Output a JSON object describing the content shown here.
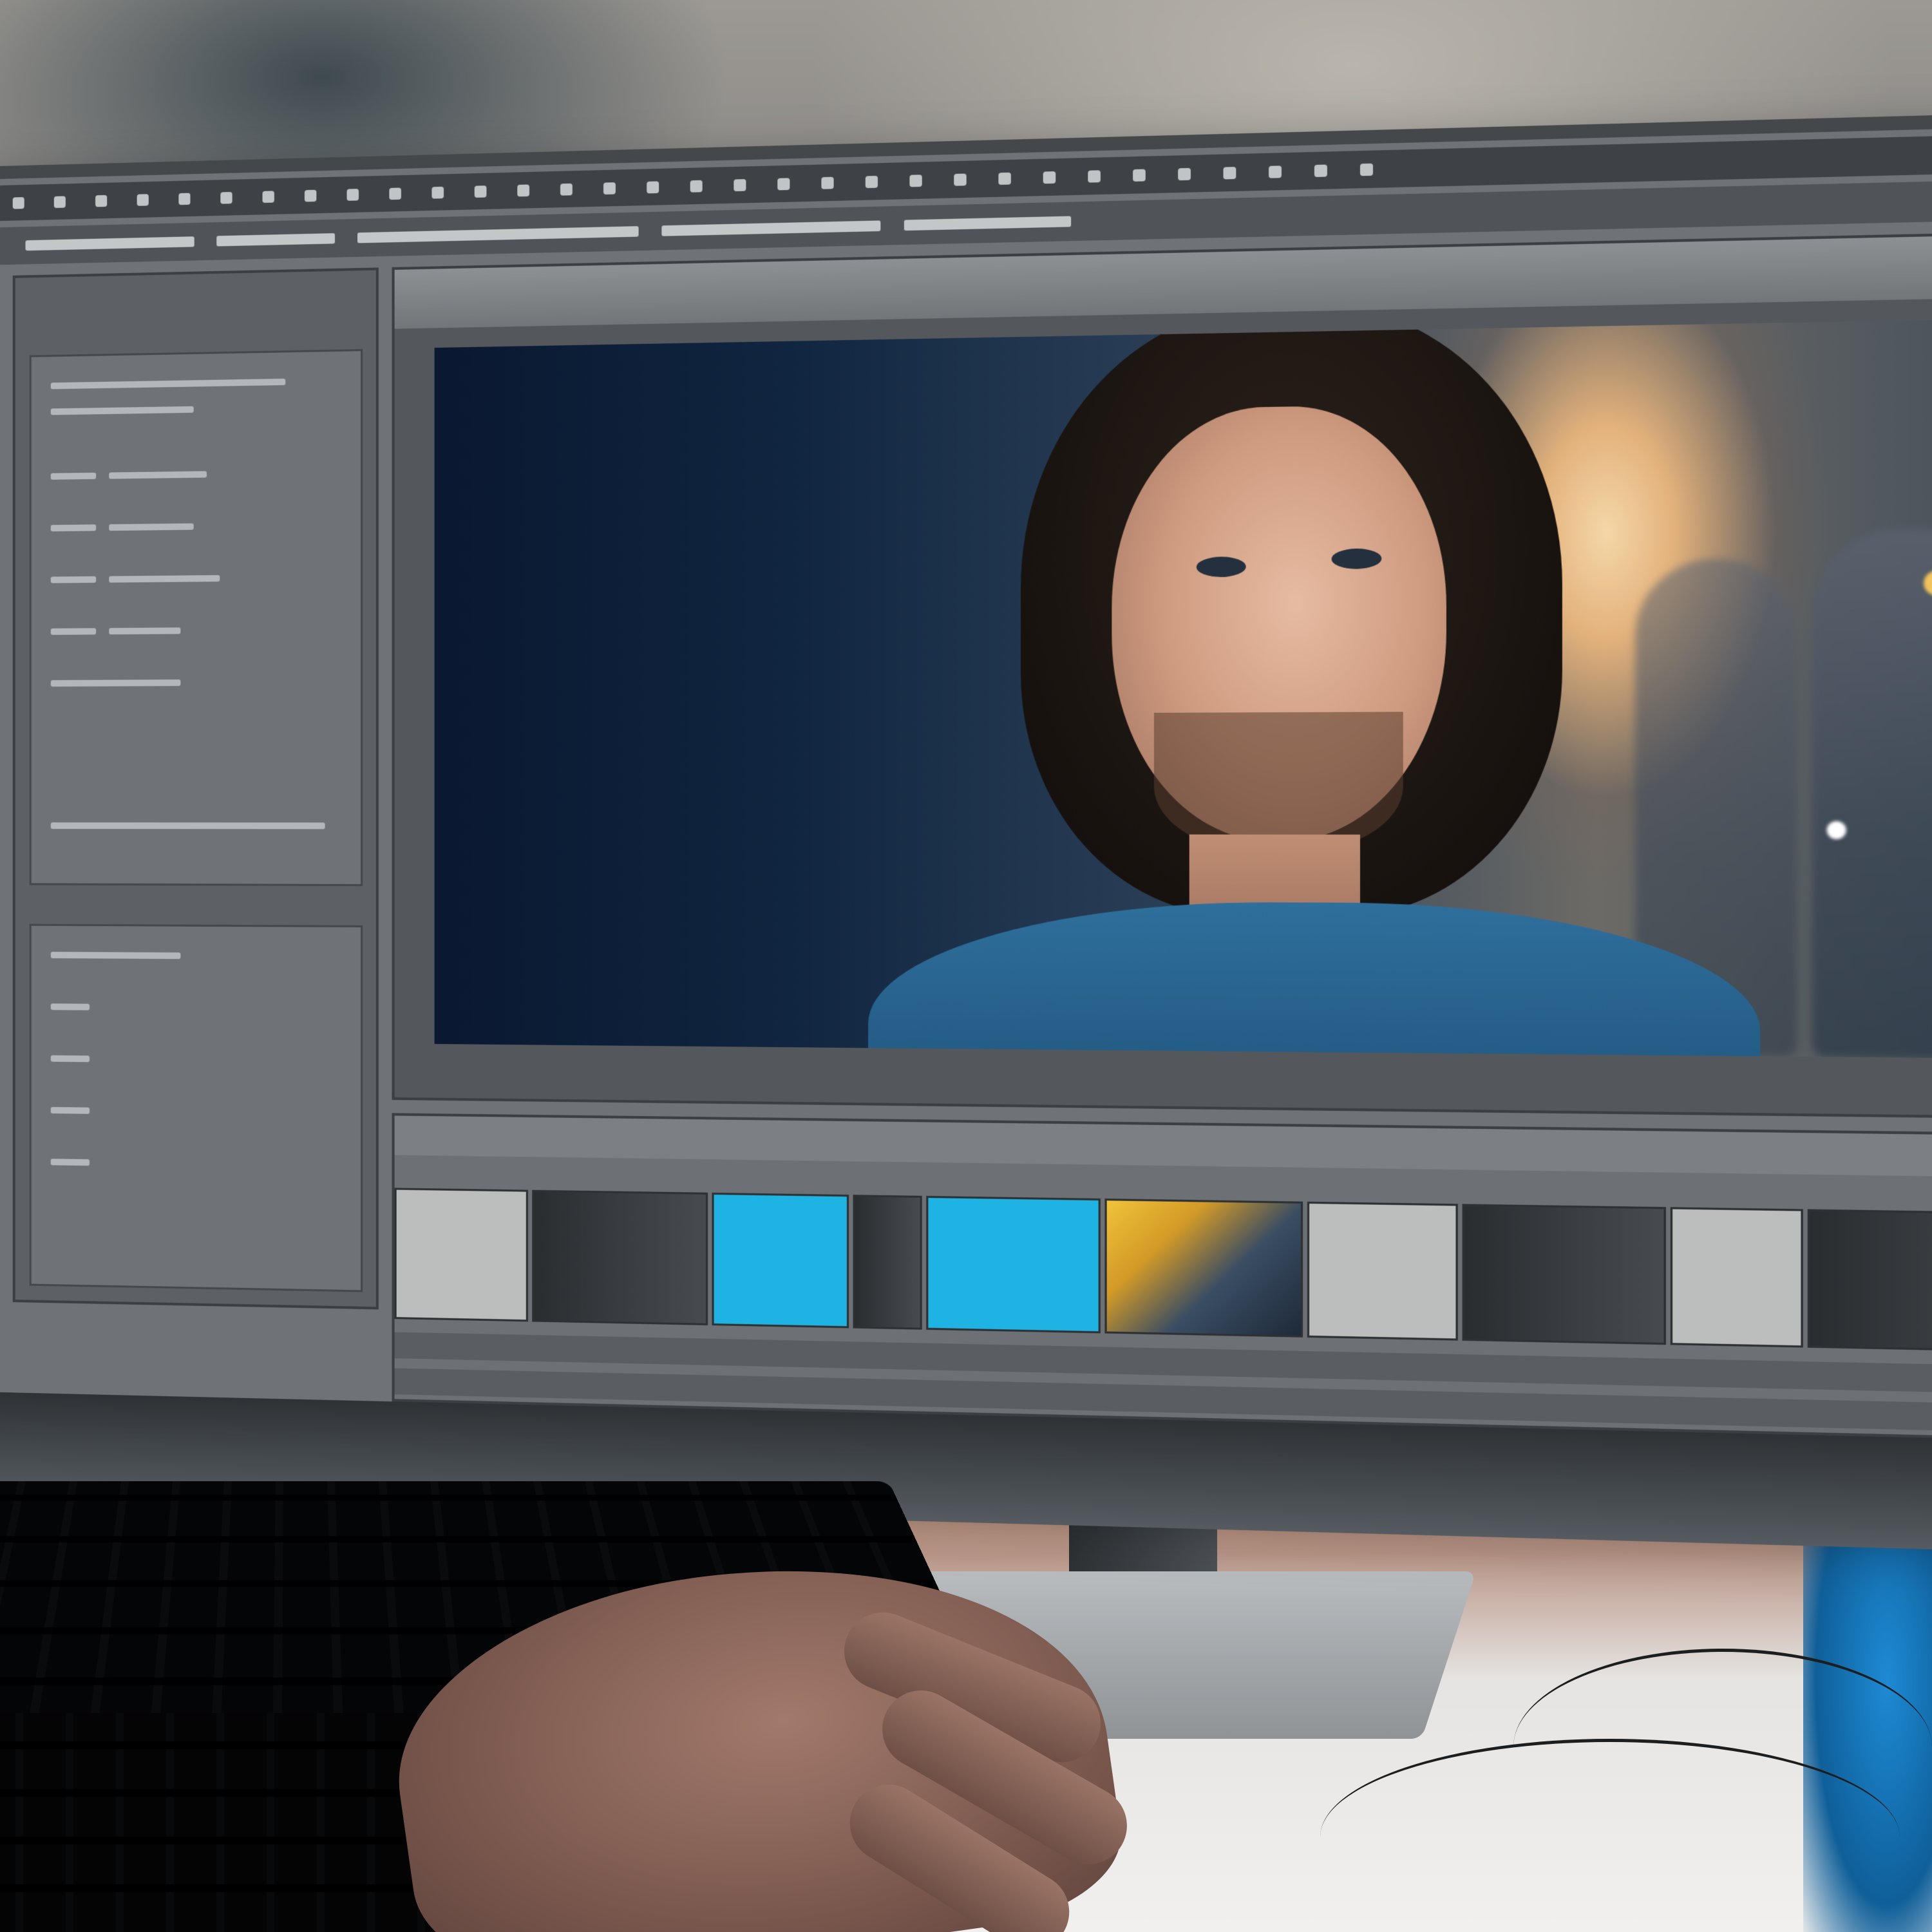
{
  "scene": {
    "subject": "",
    "colors": {
      "desk_warm": "#c99577",
      "monitor": "#44484b",
      "accent_cyan": "#1fb3e3",
      "shirt_blue": "#235b84",
      "hair": "#1b1511"
    },
    "timeline_clips": [
      {
        "kind": "grey"
      },
      {
        "kind": "dark"
      },
      {
        "kind": "cyan"
      },
      {
        "kind": "dark"
      },
      {
        "kind": "cyan"
      },
      {
        "kind": "warm"
      },
      {
        "kind": "grey"
      },
      {
        "kind": "dark"
      },
      {
        "kind": "grey"
      },
      {
        "kind": "dark"
      }
    ]
  }
}
